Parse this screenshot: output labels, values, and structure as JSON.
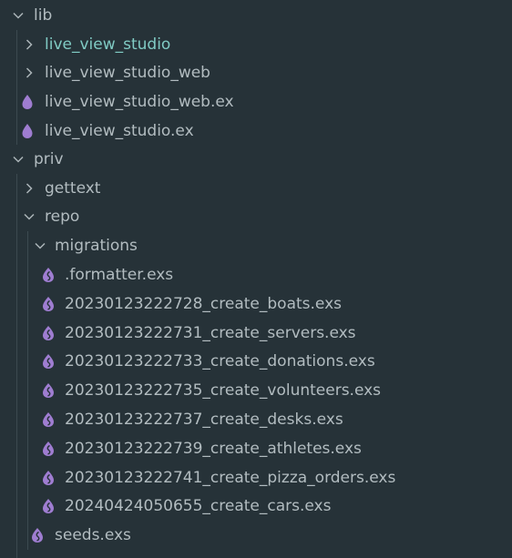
{
  "tree": {
    "rows": [
      {
        "label": "lib",
        "type": "folder",
        "expanded": true
      },
      {
        "label": "live_view_studio",
        "type": "folder",
        "expanded": false,
        "active": true
      },
      {
        "label": "live_view_studio_web",
        "type": "folder",
        "expanded": false
      },
      {
        "label": "live_view_studio_web.ex",
        "type": "file",
        "icon": "elixir-drop-icon"
      },
      {
        "label": "live_view_studio.ex",
        "type": "file",
        "icon": "elixir-drop-icon"
      },
      {
        "label": "priv",
        "type": "folder",
        "expanded": true
      },
      {
        "label": "gettext",
        "type": "folder",
        "expanded": false
      },
      {
        "label": "repo",
        "type": "folder",
        "expanded": true
      },
      {
        "label": "migrations",
        "type": "folder",
        "expanded": true
      },
      {
        "label": ".formatter.exs",
        "type": "file",
        "icon": "elixir-script-icon"
      },
      {
        "label": "20230123222728_create_boats.exs",
        "type": "file",
        "icon": "elixir-script-icon"
      },
      {
        "label": "20230123222731_create_servers.exs",
        "type": "file",
        "icon": "elixir-script-icon"
      },
      {
        "label": "20230123222733_create_donations.exs",
        "type": "file",
        "icon": "elixir-script-icon"
      },
      {
        "label": "20230123222735_create_volunteers.exs",
        "type": "file",
        "icon": "elixir-script-icon"
      },
      {
        "label": "20230123222737_create_desks.exs",
        "type": "file",
        "icon": "elixir-script-icon"
      },
      {
        "label": "20230123222739_create_athletes.exs",
        "type": "file",
        "icon": "elixir-script-icon"
      },
      {
        "label": "20230123222741_create_pizza_orders.exs",
        "type": "file",
        "icon": "elixir-script-icon"
      },
      {
        "label": "20240424050655_create_cars.exs",
        "type": "file",
        "icon": "elixir-script-icon"
      },
      {
        "label": "seeds.exs",
        "type": "file",
        "icon": "elixir-script-icon"
      }
    ]
  },
  "colors": {
    "background": "#263238",
    "text": "#b2bcc0",
    "active_text": "#80cbc4",
    "chevron": "#aab4b8",
    "elixir_icon": "#9f7dd1",
    "indent_guide": "#3c4a50"
  }
}
